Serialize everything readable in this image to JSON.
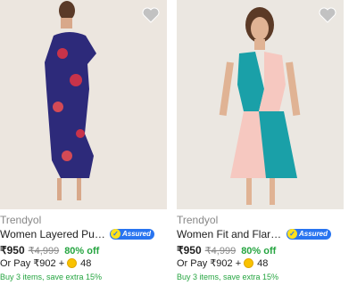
{
  "products": [
    {
      "brand": "Trendyol",
      "title": "Women Layered Purple Dre...",
      "assured_label": "Assured",
      "price": "₹950",
      "mrp": "₹4,999",
      "discount": "80% off",
      "pay_prefix": "Or Pay ₹902 +",
      "pay_coins": "48",
      "offer": "Buy 3 items, save extra 15%"
    },
    {
      "brand": "Trendyol",
      "title": "Women Fit and Flare Blue, ...",
      "assured_label": "Assured",
      "price": "₹950",
      "mrp": "₹4,999",
      "discount": "80% off",
      "pay_prefix": "Or Pay ₹902 +",
      "pay_coins": "48",
      "offer": "Buy 3 items, save extra 15%"
    }
  ],
  "icons": {
    "wishlist": "heart-icon",
    "assured": "assured-badge-icon",
    "coin": "supercoin-icon"
  },
  "colors": {
    "assured_blue": "#2874f0",
    "discount_green": "#26a541",
    "muted_text": "#878787"
  }
}
